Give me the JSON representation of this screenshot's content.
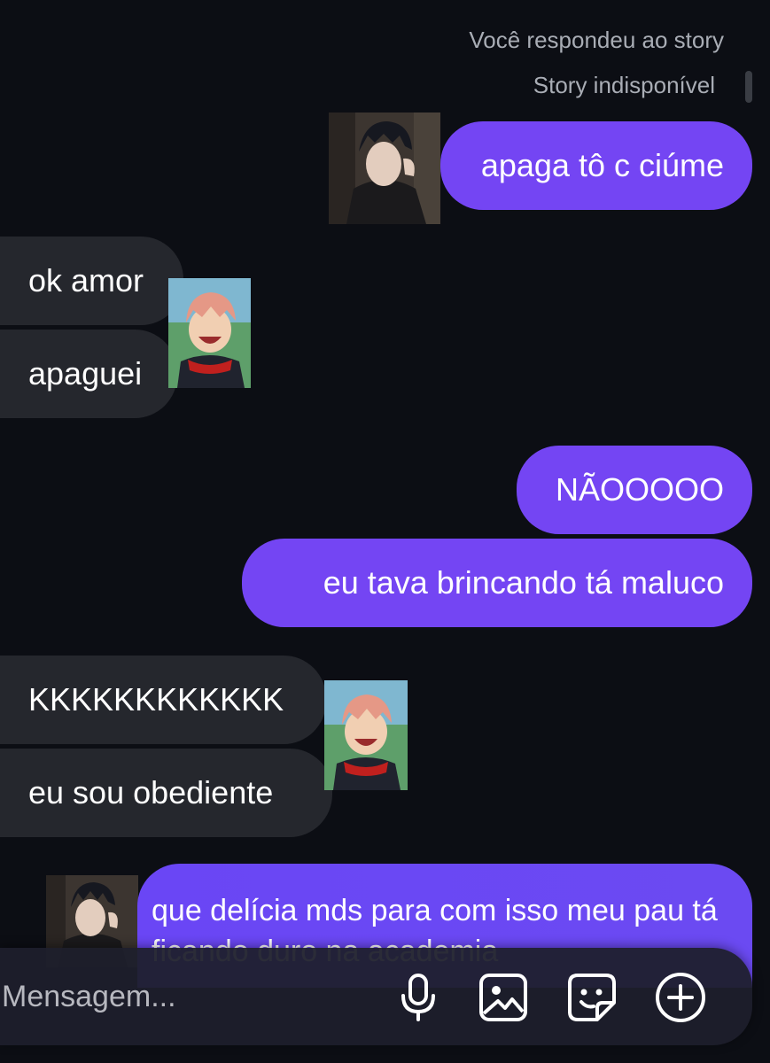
{
  "story": {
    "replied_label": "Você respondeu ao story",
    "unavailable_label": "Story indisponível"
  },
  "messages": [
    {
      "side": "out",
      "text": "apaga tô c ciúme"
    },
    {
      "side": "in",
      "text": "ok amor"
    },
    {
      "side": "in",
      "text": "apaguei"
    },
    {
      "side": "out",
      "text": "NÃOOOOO"
    },
    {
      "side": "out",
      "text": "eu tava brincando tá maluco"
    },
    {
      "side": "in",
      "text": "KKKKKKKKKKKK"
    },
    {
      "side": "in",
      "text": "eu sou obediente"
    },
    {
      "side": "out",
      "text": "que delícia mds para com isso meu pau tá ficando duro na academia"
    }
  ],
  "composer": {
    "placeholder": "Mensagem...",
    "icons": [
      "microphone-icon",
      "image-icon",
      "sticker-icon",
      "plus-circle-icon"
    ]
  },
  "colors": {
    "background": "#0c0e14",
    "outgoing_bubble": "#7445f3",
    "incoming_bubble": "#25272d"
  }
}
